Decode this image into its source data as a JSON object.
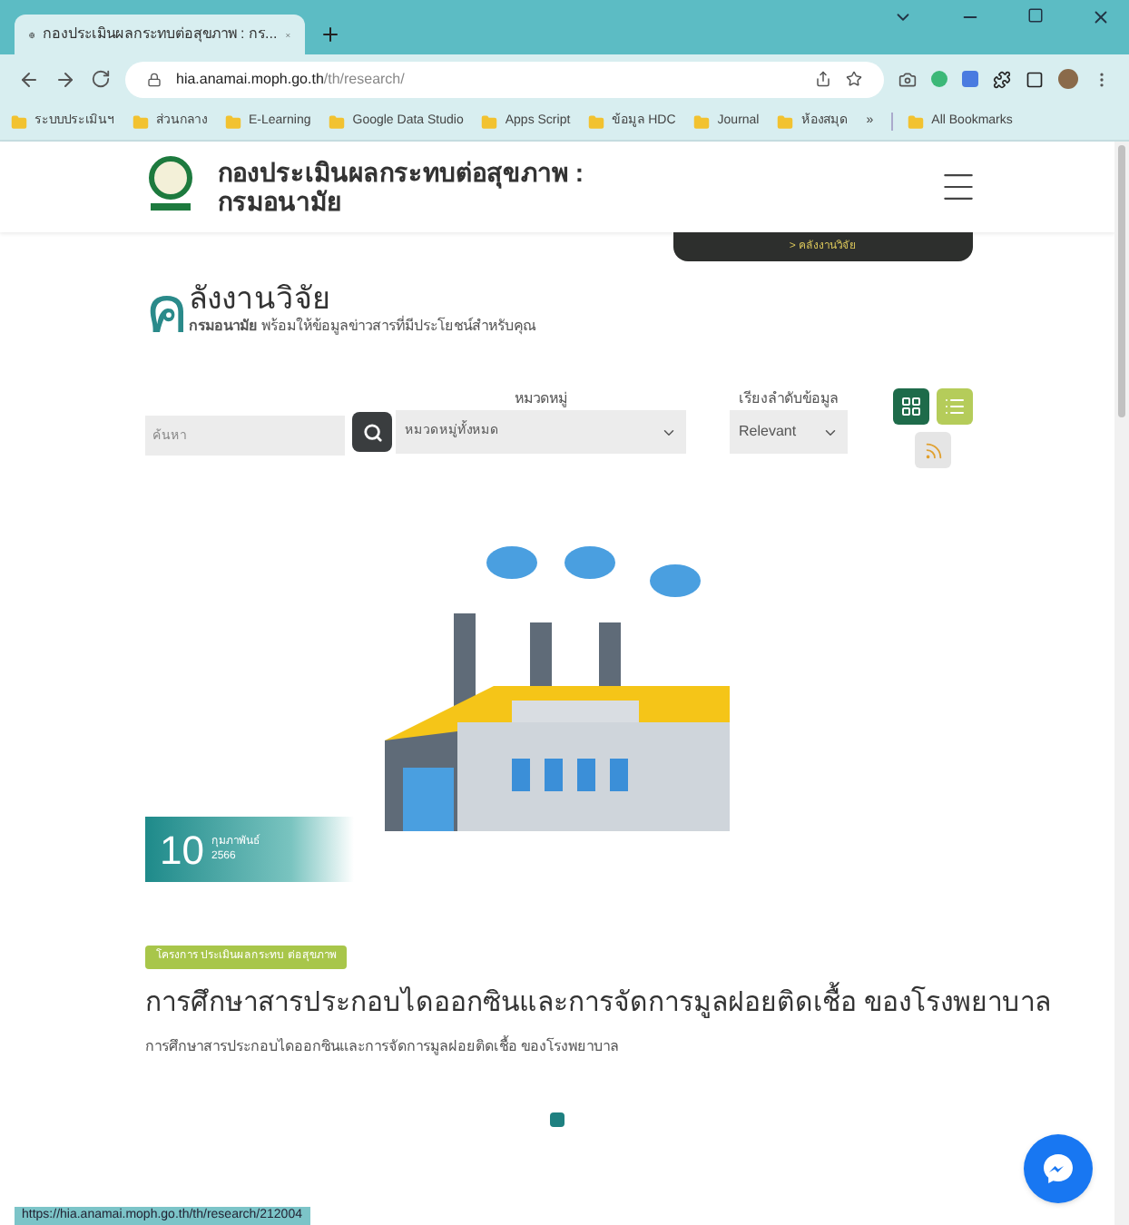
{
  "browser": {
    "tab": {
      "title": "กองประเมินผลกระทบต่อสุขภาพ : กร...",
      "selected": true
    },
    "url": {
      "host": "hia.anamai.moph.go.th",
      "path": "/th/research/"
    },
    "bookmarks": [
      "ระบบประเมินฯ",
      "ส่วนกลาง",
      "E-Learning",
      "Google Data Studio",
      "Apps Script",
      "ข้อมูล HDC",
      "Journal",
      "ห้องสมุด"
    ],
    "bookmarks_more": "»",
    "all_bookmarks": "All Bookmarks"
  },
  "site": {
    "title": "กองประเมินผลกระทบต่อสุขภาพ : กรมอนามัย",
    "menu_link": "> คลังงานวิจัย"
  },
  "heading": {
    "initial": "ค",
    "title": "ลังงานวิจัย",
    "subtitle": "**กรมอนามัย** พร้อมให้ข้อมูลข่าวสารที่มีประโยชน์สำหรับคุณ"
  },
  "filters": {
    "search": {
      "placeholder": "ค้นหา"
    },
    "category": {
      "label": "หมวดหมู่",
      "value": "หมวดหมู่ทั้งหมด"
    },
    "sort": {
      "label": "เรียงลำดับข้อมูล",
      "value": "Relevant"
    },
    "views": [
      {
        "kind": "grid",
        "selected": true
      },
      {
        "kind": "list",
        "selected": false
      },
      {
        "kind": "rss",
        "selected": false
      }
    ]
  },
  "post": {
    "day": "10",
    "month": "กุมภาพันธ์",
    "year": "2566",
    "tag": "โครงการ ประเมินผลกระทบ ต่อสุขภาพ",
    "title": "การศึกษาสารประกอบไดออกซินและการจัดการมูลฝอยติดเชื้อ ของโรงพยาบาล",
    "excerpt": "การศึกษาสารประกอบไดออกซินและการจัดการมูลฝอยติดเชื้อ ของโรงพยาบาล"
  },
  "carousel": [
    {
      "selected": true
    }
  ],
  "status_url": "https://hia.anamai.moph.go.th/th/research/212004"
}
